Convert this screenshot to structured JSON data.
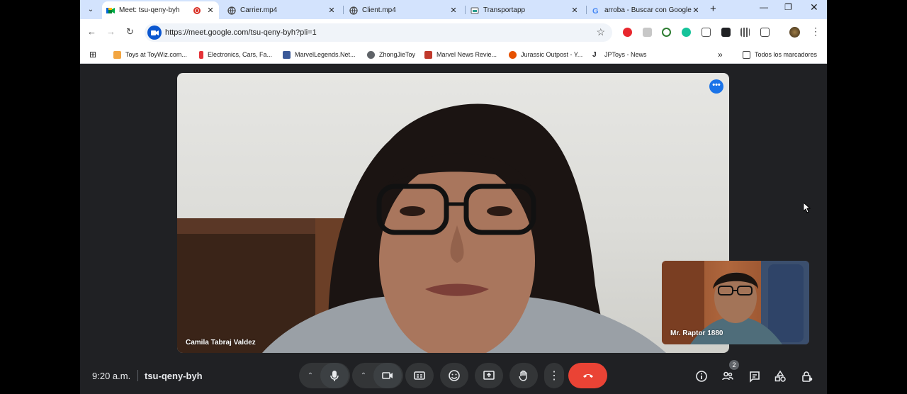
{
  "browser": {
    "tabs": [
      {
        "title": "Meet: tsu-qeny-byh",
        "active": true,
        "recording": true
      },
      {
        "title": "Carrier.mp4",
        "active": false
      },
      {
        "title": "Client.mp4",
        "active": false
      },
      {
        "title": "Transportapp",
        "active": false
      },
      {
        "title": "arroba - Buscar con Google",
        "active": false
      }
    ],
    "url": "https://meet.google.com/tsu-qeny-byh?pli=1",
    "bookmarks": [
      {
        "label": "Toys at ToyWiz.com...",
        "color": "#f2a541"
      },
      {
        "label": "Electronics, Cars, Fa...",
        "color": "#e53238"
      },
      {
        "label": "MarvelLegends.Net...",
        "color": "#3b5998"
      },
      {
        "label": "ZhongJieToy",
        "color": "#5f6368"
      },
      {
        "label": "Marvel News Revie...",
        "color": "#c0392b"
      },
      {
        "label": "Jurassic Outpost - Y...",
        "color": "#e65100"
      },
      {
        "label": "JPToys - News",
        "color": "#202124"
      }
    ],
    "all_bookmarks_label": "Todos los marcadores"
  },
  "meet": {
    "main_participant": "Camila Tabraj Valdez",
    "self_participant": "Mr. Raptor 1880",
    "time": "9:20 a.m.",
    "meeting_code": "tsu-qeny-byh",
    "participant_count": "2"
  },
  "colors": {
    "tabstrip": "#d3e3fd",
    "stage": "#202124",
    "hangup": "#ea4335",
    "accent": "#1a73e8"
  }
}
